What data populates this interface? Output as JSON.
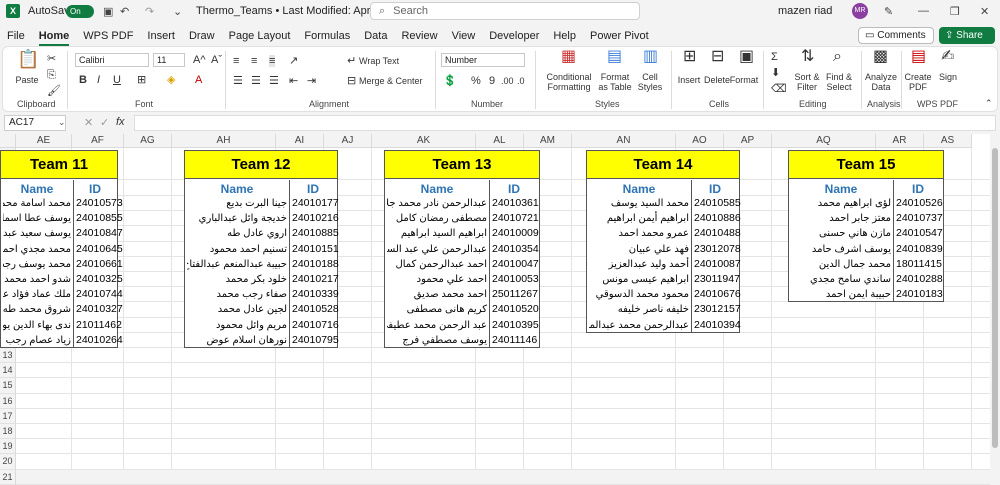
{
  "titlebar": {
    "autosave": "AutoSave",
    "toggle": "On",
    "doc_title": "Thermo_Teams • Last Modified: April 12",
    "search_placeholder": "Search",
    "user_name": "mazen riad",
    "user_initials": "MR"
  },
  "menu": [
    "File",
    "Home",
    "WPS PDF",
    "Insert",
    "Draw",
    "Page Layout",
    "Formulas",
    "Data",
    "Review",
    "View",
    "Developer",
    "Help",
    "Power Pivot"
  ],
  "menu_active": "Home",
  "comments_label": "Comments",
  "share_label": "Share",
  "ribbon": {
    "paste": "Paste",
    "clipboard": "Clipboard",
    "font_name": "Calibri",
    "font_size": "11",
    "font": "Font",
    "wrap_text": "Wrap Text",
    "merge_center": "Merge & Center",
    "alignment": "Alignment",
    "number_format": "Number",
    "number": "Number",
    "cond_fmt": "Conditional Formatting",
    "fmt_table": "Format as Table",
    "cell_styles": "Cell Styles",
    "styles": "Styles",
    "insert": "Insert",
    "delete": "Delete",
    "format": "Format",
    "cells": "Cells",
    "sort_filter": "Sort & Filter",
    "find_select": "Find & Select",
    "editing": "Editing",
    "analyze": "Analyze Data",
    "analysis": "Analysis",
    "create_pdf": "Create PDF",
    "sign": "Sign",
    "wps_pdf": "WPS PDF"
  },
  "formula": {
    "namebox": "AC17",
    "fx": "fx"
  },
  "columns": [
    "AE",
    "AF",
    "AG",
    "AH",
    "AI",
    "AJ",
    "AK",
    "AL",
    "AM",
    "AN",
    "AO",
    "AP",
    "AQ",
    "AR",
    "AS"
  ],
  "rows": [
    "1",
    "2",
    "3",
    "4",
    "5",
    "6",
    "7",
    "8",
    "9",
    "10",
    "11",
    "12",
    "13",
    "14",
    "15",
    "16",
    "17",
    "18",
    "19",
    "20",
    "21"
  ],
  "teams": [
    {
      "title": "Team 11",
      "name_hdr": "Name",
      "id_hdr": "ID",
      "members": [
        {
          "name": "محمد اسامة محمد عبدالعزيز",
          "id": "24010573"
        },
        {
          "name": "يوسف عطا اسماعيل",
          "id": "24010855"
        },
        {
          "name": "يوسف سعيد عبدالمنعم",
          "id": "24010847"
        },
        {
          "name": "محمد مجدي احمد",
          "id": "24010645"
        },
        {
          "name": "محمد يوسف رجب",
          "id": "24010661"
        },
        {
          "name": "شدو احمد محمد احمد",
          "id": "24010325"
        },
        {
          "name": "ملك عماد فؤاد عطية",
          "id": "24010744"
        },
        {
          "name": "شروق محمد طه سالم",
          "id": "24010327"
        },
        {
          "name": "ندى بهاء الدين يوسف",
          "id": "21011462"
        },
        {
          "name": "زياد عصام رجب",
          "id": "24010264"
        }
      ]
    },
    {
      "title": "Team 12",
      "name_hdr": "Name",
      "id_hdr": "ID",
      "members": [
        {
          "name": "جينا البرت بديع",
          "id": "24010177"
        },
        {
          "name": "خديجة وائل عبدالباري",
          "id": "24010216"
        },
        {
          "name": "اروي عادل طه",
          "id": "24010885"
        },
        {
          "name": "تسنيم احمد محمود",
          "id": "24010151"
        },
        {
          "name": "حبيبة عبدالمنعم عبدالفتاح",
          "id": "24010188"
        },
        {
          "name": "خلود بكر محمد",
          "id": "24010217"
        },
        {
          "name": "صفاء رجب محمد",
          "id": "24010339"
        },
        {
          "name": "لجين عادل محمد",
          "id": "24010528"
        },
        {
          "name": "مريم وائل محمود",
          "id": "24010716"
        },
        {
          "name": "نورهان اسلام عوض",
          "id": "24010795"
        }
      ]
    },
    {
      "title": "Team 13",
      "name_hdr": "Name",
      "id_hdr": "ID",
      "members": [
        {
          "name": "عبدالرحمن نادر محمد جلال",
          "id": "24010361"
        },
        {
          "name": "مصطفى رمضان كامل",
          "id": "24010721"
        },
        {
          "name": "ابراهيم السيد ابراهيم",
          "id": "24010009"
        },
        {
          "name": "عبدالرحمن علي عبد السلام",
          "id": "24010354"
        },
        {
          "name": "احمد عبدالرحمن كمال",
          "id": "24010047"
        },
        {
          "name": "احمد علي محمود",
          "id": "24010053"
        },
        {
          "name": "احمد محمد صديق",
          "id": "25011267"
        },
        {
          "name": "كريم هانى مصطفى",
          "id": "24010520"
        },
        {
          "name": "عبد الرحمن محمد عطيفي",
          "id": "24010395"
        },
        {
          "name": "يوسف مصطفي فرج",
          "id": "24011146"
        }
      ]
    },
    {
      "title": "Team 14",
      "name_hdr": "Name",
      "id_hdr": "ID",
      "members": [
        {
          "name": "محمد السيد يوسف",
          "id": "24010585"
        },
        {
          "name": "ابراهيم أيمن ابراهيم",
          "id": "24010886"
        },
        {
          "name": "عمرو محمد احمد",
          "id": "24010488"
        },
        {
          "name": "فهد علي عبيان",
          "id": "23012078"
        },
        {
          "name": "أحمد وليد عبدالعزيز",
          "id": "24010087"
        },
        {
          "name": "ابراهيم عيسى مونس",
          "id": "23011947"
        },
        {
          "name": "محمود محمد الدسوقي",
          "id": "24010676"
        },
        {
          "name": "خليفه ناصر خليفه",
          "id": "23012157"
        },
        {
          "name": "عبدالرحمن محمد عبدالمنعم",
          "id": "24010394"
        }
      ]
    },
    {
      "title": "Team 15",
      "name_hdr": "Name",
      "id_hdr": "ID",
      "members": [
        {
          "name": "لؤى ابراهيم محمد",
          "id": "24010526"
        },
        {
          "name": "معتز جابر احمد",
          "id": "24010737"
        },
        {
          "name": "مازن هاني حسنى",
          "id": "24010547"
        },
        {
          "name": "يوسف اشرف حامد",
          "id": "24010839"
        },
        {
          "name": "محمد جمال الدين",
          "id": "18011415"
        },
        {
          "name": "ساندي سامح مجدي",
          "id": "24010288"
        },
        {
          "name": "حبيبة ايمن احمد",
          "id": "24010183"
        }
      ]
    }
  ]
}
